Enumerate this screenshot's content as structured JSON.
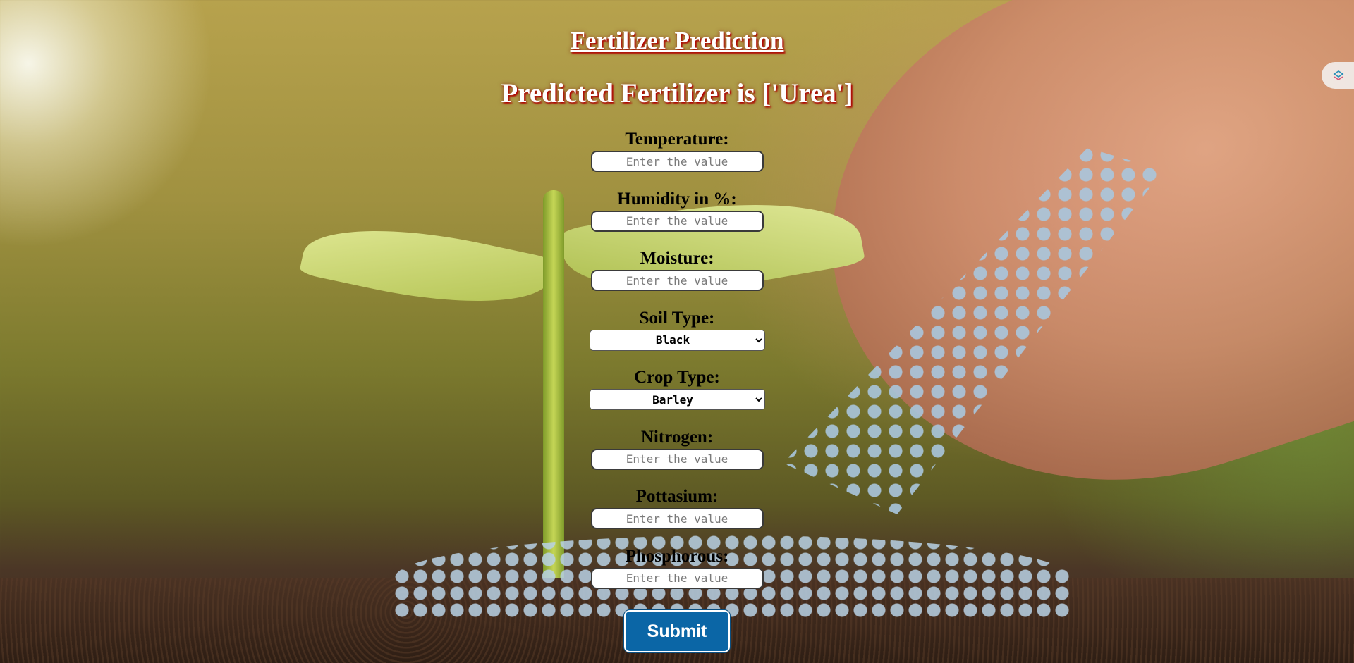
{
  "page": {
    "title": "Fertilizer Prediction",
    "result": "Predicted Fertilizer is ['Urea']"
  },
  "form": {
    "fields": [
      {
        "label": "Temperature:",
        "type": "text",
        "placeholder": "Enter the value"
      },
      {
        "label": "Humidity in %:",
        "type": "text",
        "placeholder": "Enter the value"
      },
      {
        "label": "Moisture:",
        "type": "text",
        "placeholder": "Enter the value"
      },
      {
        "label": "Soil Type:",
        "type": "select",
        "value": "Black"
      },
      {
        "label": "Crop Type:",
        "type": "select",
        "value": "Barley"
      },
      {
        "label": "Nitrogen:",
        "type": "text",
        "placeholder": "Enter the value"
      },
      {
        "label": "Pottasium:",
        "type": "text",
        "placeholder": "Enter the value"
      },
      {
        "label": "Phosphorous:",
        "type": "text",
        "placeholder": "Enter the value"
      }
    ],
    "submit_label": "Submit"
  },
  "colors": {
    "title_text": "#ffffff",
    "title_shadow": "#b00000",
    "button_bg": "#0b66a6",
    "button_text": "#ffffff"
  },
  "icons": {
    "extension": "extension-icon"
  }
}
